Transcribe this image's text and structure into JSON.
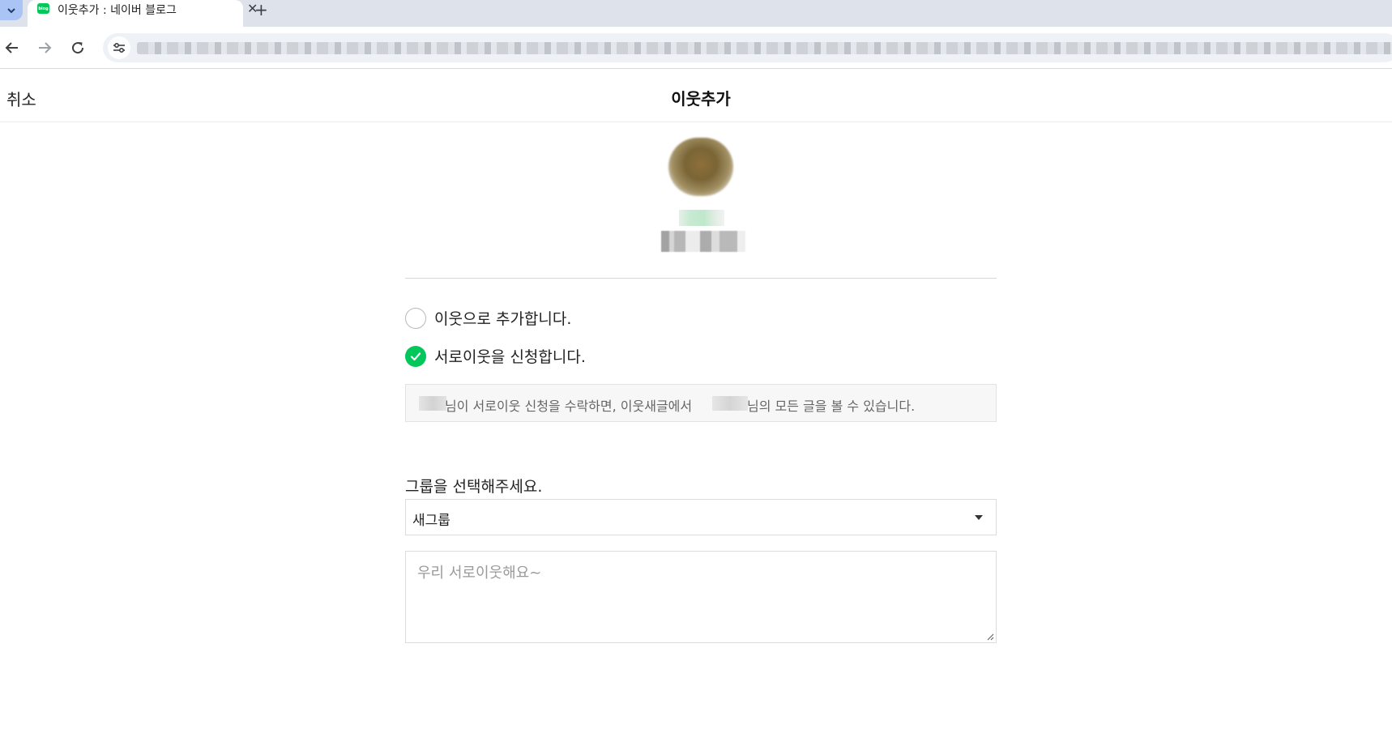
{
  "browser": {
    "tab_title": "이웃추가 : 네이버 블로그",
    "favicon_text": "blog",
    "close_glyph": "✕",
    "new_tab_glyph": "+"
  },
  "header": {
    "cancel_label": "취소",
    "title": "이웃추가"
  },
  "options": {
    "neighbor_label": "이웃으로 추가합니다.",
    "mutual_label": "서로이웃을 신청합니다.",
    "selected": "mutual"
  },
  "info": {
    "text_part1": "님이 서로이웃 신청을 수락하면, 이웃새글에서",
    "text_part2": "님의 모든 글을 볼 수 있습니다."
  },
  "group": {
    "label": "그룹을 선택해주세요.",
    "selected_value": "새그룹"
  },
  "message": {
    "placeholder": "우리 서로이웃해요~"
  },
  "colors": {
    "accent_green": "#03c75a"
  }
}
